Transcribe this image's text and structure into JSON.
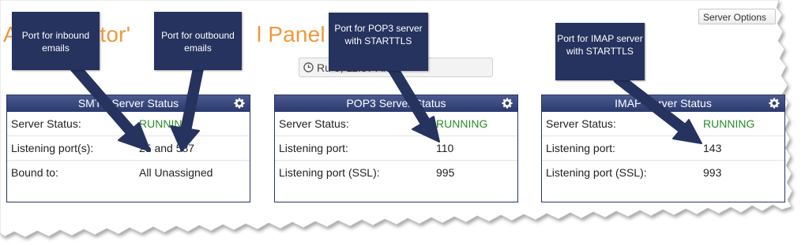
{
  "page": {
    "title": "Administrator's Control Panel",
    "title_visible": "A          rator'                    l Panel",
    "server_options_label": "Server Options",
    "running_since": "Ru                              6, 11:37 AM"
  },
  "panels": [
    {
      "header": "SMTP Server Status",
      "rows": [
        {
          "label": "Server Status:",
          "value": "RUNNING"
        },
        {
          "label": "Listening port(s):",
          "value": "25 and 587"
        },
        {
          "label": "Bound to:",
          "value": "All Unassigned"
        }
      ]
    },
    {
      "header": "POP3 Server Status",
      "rows": [
        {
          "label": "Server Status:",
          "value": "RUNNING"
        },
        {
          "label": "Listening port:",
          "value": "110"
        },
        {
          "label": "Listening port (SSL):",
          "value": "995"
        }
      ]
    },
    {
      "header": "IMAP Server Status",
      "rows": [
        {
          "label": "Server Status:",
          "value": "RUNNING"
        },
        {
          "label": "Listening port:",
          "value": "143"
        },
        {
          "label": "Listening port (SSL):",
          "value": "993"
        }
      ]
    }
  ],
  "callouts": [
    {
      "text": "Port for inbound emails"
    },
    {
      "text": "Port for outbound emails"
    },
    {
      "text": "Port for POP3 server with STARTTLS"
    },
    {
      "text": "Port for IMAP server with STARTTLS"
    }
  ],
  "colors": {
    "title_orange": "#f0983c",
    "header_navy": "#2b3a6e",
    "callout_navy": "#26335f",
    "status_green": "#2a8a2a"
  },
  "icons": [
    "gear-icon",
    "clock-icon",
    "arrow-icon"
  ]
}
